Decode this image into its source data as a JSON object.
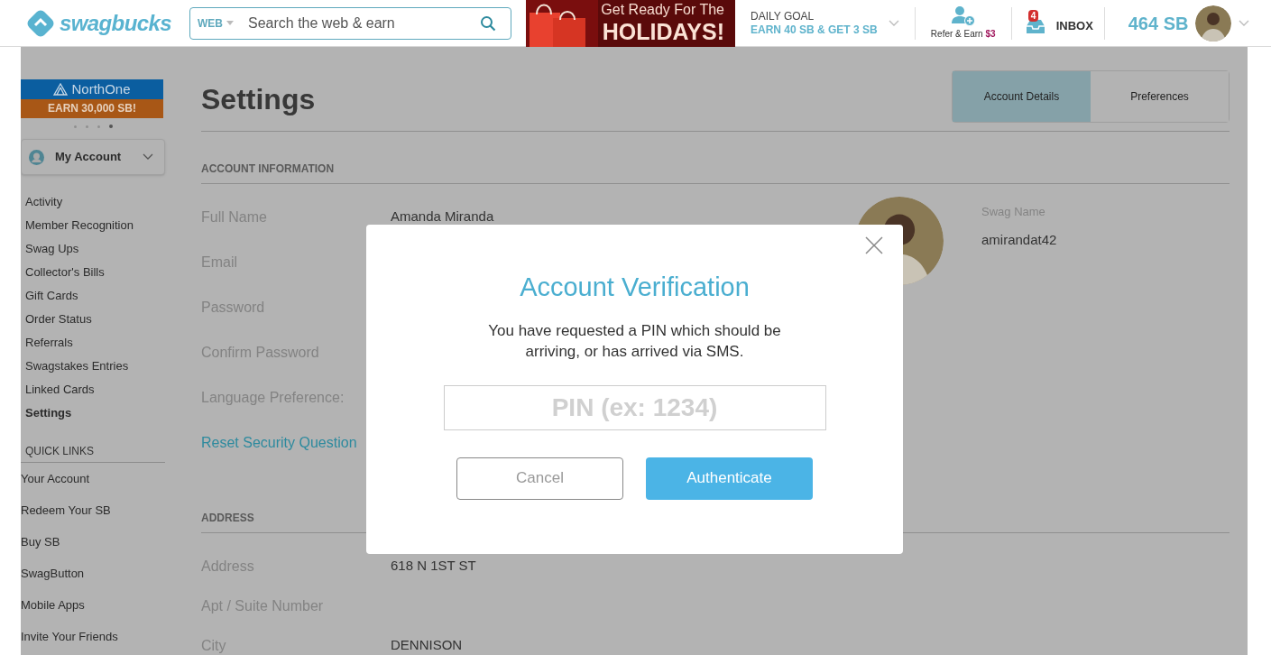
{
  "header": {
    "logo": "swagbucks",
    "search": {
      "scope": "WEB",
      "placeholder": "Search the web & earn"
    },
    "ad": {
      "line_1": "Get Ready For The",
      "line_2": "HOLIDAYS!"
    },
    "daily_goal": {
      "label": "DAILY GOAL",
      "value": "EARN 40 SB & GET 3 SB"
    },
    "refer": {
      "label": "Refer & Earn",
      "amount": "$3"
    },
    "inbox": {
      "badge": "4",
      "label": "INBOX"
    },
    "balance": "464 SB"
  },
  "sidebar": {
    "promo": {
      "brand": "NorthOne",
      "offer": "EARN 30,000 SB!"
    },
    "carousel_dots": [
      {
        "selected": false
      },
      {
        "selected": false
      },
      {
        "selected": false
      },
      {
        "selected": true
      }
    ],
    "account_menu": "My Account",
    "nav": [
      {
        "label": "Activity",
        "selected": false
      },
      {
        "label": "Member Recognition",
        "selected": false
      },
      {
        "label": "Swag Ups",
        "selected": false
      },
      {
        "label": "Collector's Bills",
        "selected": false
      },
      {
        "label": "Gift Cards",
        "selected": false
      },
      {
        "label": "Order Status",
        "selected": false
      },
      {
        "label": "Referrals",
        "selected": false
      },
      {
        "label": "Swagstakes Entries",
        "selected": false
      },
      {
        "label": "Linked Cards",
        "selected": false
      },
      {
        "label": "Settings",
        "selected": true
      }
    ],
    "quick_links": {
      "title": "QUICK LINKS",
      "items": [
        "Your Account",
        "Redeem Your SB",
        "Buy SB",
        "SwagButton",
        "Mobile Apps",
        "Invite Your Friends"
      ]
    }
  },
  "main": {
    "title": "Settings",
    "tabs": [
      {
        "label": "Account Details",
        "selected": true
      },
      {
        "label": "Preferences",
        "selected": false
      }
    ],
    "account_information": {
      "title": "ACCOUNT INFORMATION",
      "fields": [
        {
          "label": "Full Name",
          "value": "Amanda Miranda"
        },
        {
          "label": "Email"
        },
        {
          "label": "Password"
        },
        {
          "label": "Confirm Password"
        },
        {
          "label": "Language Preference:"
        }
      ],
      "link": "Reset Security Question"
    },
    "profile": {
      "swag_name_label": "Swag Name",
      "swag_name": "amirandat42"
    },
    "address": {
      "title": "ADDRESS",
      "fields": [
        {
          "label": "Address",
          "value": "618 N 1ST ST"
        },
        {
          "label": "Apt / Suite Number"
        },
        {
          "label": "City",
          "value": "DENNISON"
        }
      ]
    }
  },
  "modal": {
    "title": "Account Verification",
    "message": "You have requested a PIN which should be arriving, or has arrived via SMS.",
    "pin_placeholder": "PIN (ex: 1234)",
    "cancel": "Cancel",
    "authenticate": "Authenticate"
  }
}
